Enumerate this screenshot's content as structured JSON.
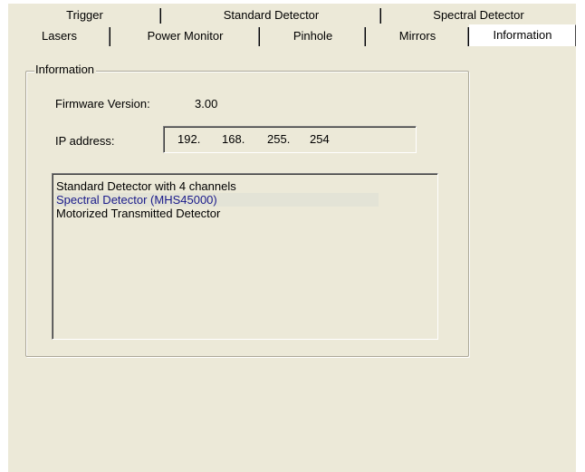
{
  "tabs": {
    "back_row": [
      {
        "label": "Trigger"
      },
      {
        "label": "Standard Detector"
      },
      {
        "label": "Spectral Detector"
      }
    ],
    "front_row": [
      {
        "label": "Lasers"
      },
      {
        "label": "Power Monitor"
      },
      {
        "label": "Pinhole"
      },
      {
        "label": "Mirrors"
      },
      {
        "label": "Information",
        "active": true
      }
    ]
  },
  "information": {
    "group_title": "Information",
    "firmware_label": "Firmware Version:",
    "firmware_value": "3.00",
    "ip_label": "IP address:",
    "ip_octets": [
      "192.",
      "168.",
      "255.",
      "254"
    ],
    "detectors": [
      "Standard Detector with 4 channels",
      "Spectral Detector (MHS45000)",
      "Motorized Transmitted Detector"
    ]
  },
  "colors": {
    "panel_bg": "#ece9d8",
    "page_bg": "#ffffff",
    "groupbox_border": "#aca899",
    "highlight_row": "#e3e3d6"
  }
}
